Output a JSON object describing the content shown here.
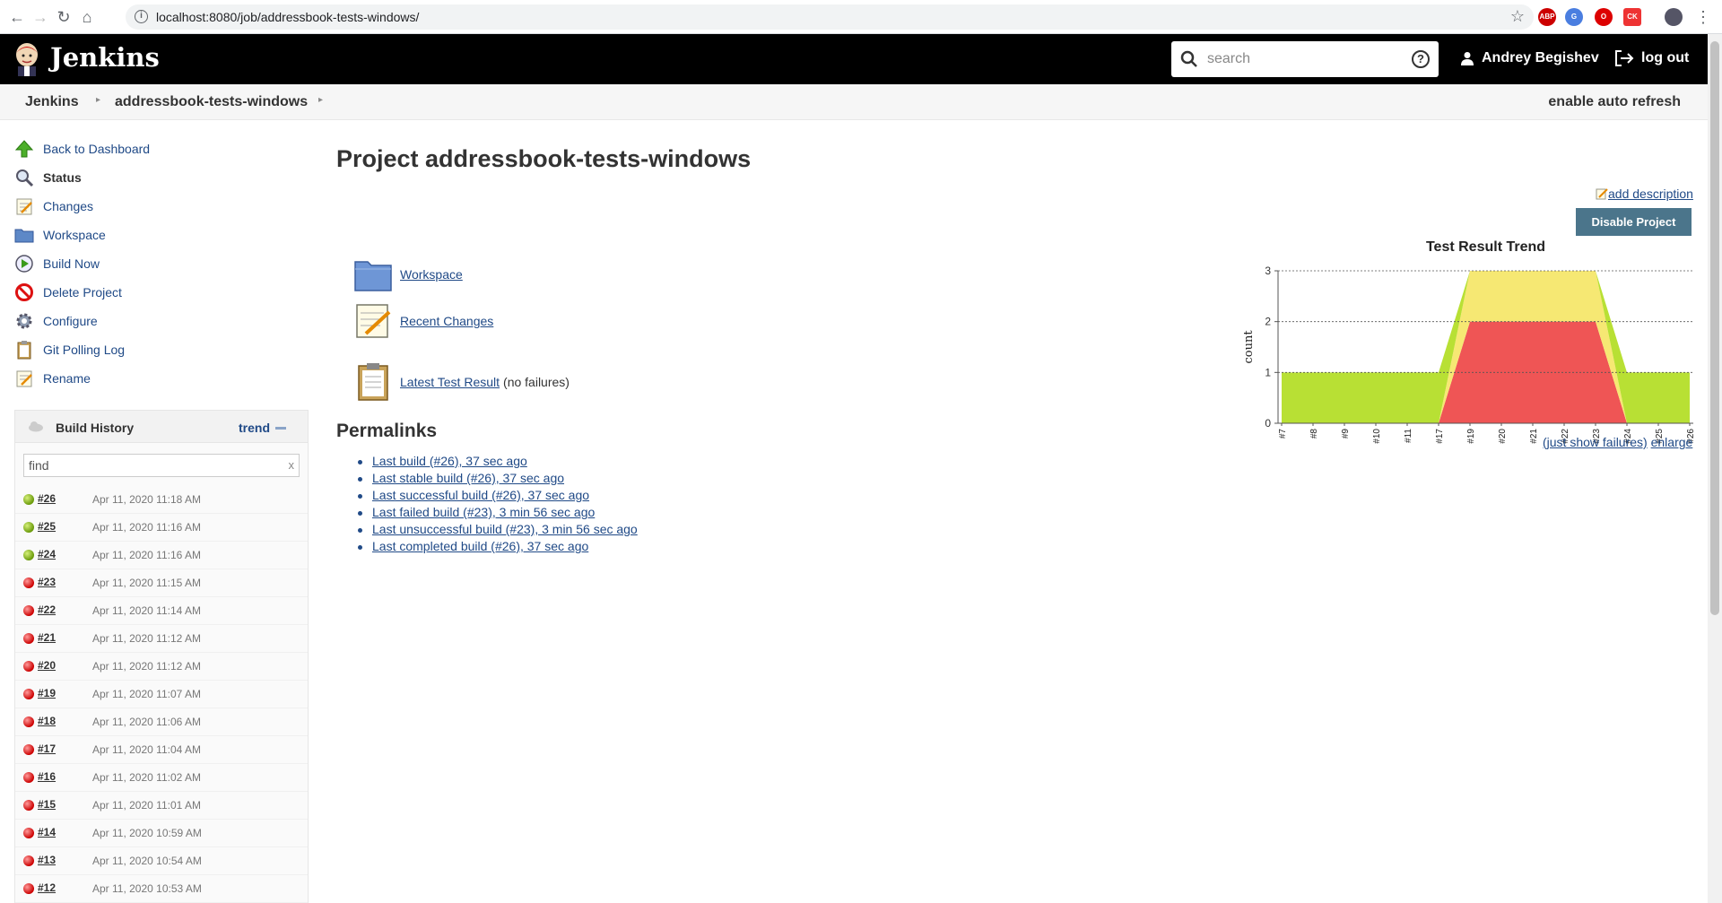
{
  "browser": {
    "url": "localhost:8080/job/addressbook-tests-windows/",
    "ext_labels": [
      "ABP",
      "G",
      "O",
      "CK"
    ]
  },
  "header": {
    "app_title": "Jenkins",
    "search_placeholder": "search",
    "help_label": "?",
    "user_name": "Andrey Begishev",
    "logout_label": "log out"
  },
  "breadcrumbs": {
    "items": [
      "Jenkins",
      "addressbook-tests-windows"
    ],
    "auto_refresh": "enable auto refresh"
  },
  "sidepanel": {
    "tasks": [
      {
        "label": "Back to Dashboard",
        "icon": "up-arrow-icon"
      },
      {
        "label": "Status",
        "icon": "search-icon"
      },
      {
        "label": "Changes",
        "icon": "notepad-icon"
      },
      {
        "label": "Workspace",
        "icon": "folder-icon"
      },
      {
        "label": "Build Now",
        "icon": "clock-play-icon"
      },
      {
        "label": "Delete Project",
        "icon": "no-entry-icon"
      },
      {
        "label": "Configure",
        "icon": "gear-icon"
      },
      {
        "label": "Git Polling Log",
        "icon": "clipboard-icon"
      },
      {
        "label": "Rename",
        "icon": "notepad-icon"
      }
    ]
  },
  "history": {
    "title": "Build History",
    "trend_label": "trend",
    "find_value": "find",
    "clear_label": "x",
    "builds": [
      {
        "num": "#26",
        "date": "Apr 11, 2020 11:18 AM",
        "status": "green"
      },
      {
        "num": "#25",
        "date": "Apr 11, 2020 11:16 AM",
        "status": "green"
      },
      {
        "num": "#24",
        "date": "Apr 11, 2020 11:16 AM",
        "status": "green"
      },
      {
        "num": "#23",
        "date": "Apr 11, 2020 11:15 AM",
        "status": "red"
      },
      {
        "num": "#22",
        "date": "Apr 11, 2020 11:14 AM",
        "status": "red"
      },
      {
        "num": "#21",
        "date": "Apr 11, 2020 11:12 AM",
        "status": "red"
      },
      {
        "num": "#20",
        "date": "Apr 11, 2020 11:12 AM",
        "status": "red"
      },
      {
        "num": "#19",
        "date": "Apr 11, 2020 11:07 AM",
        "status": "red"
      },
      {
        "num": "#18",
        "date": "Apr 11, 2020 11:06 AM",
        "status": "red"
      },
      {
        "num": "#17",
        "date": "Apr 11, 2020 11:04 AM",
        "status": "red"
      },
      {
        "num": "#16",
        "date": "Apr 11, 2020 11:02 AM",
        "status": "red"
      },
      {
        "num": "#15",
        "date": "Apr 11, 2020 11:01 AM",
        "status": "red"
      },
      {
        "num": "#14",
        "date": "Apr 11, 2020 10:59 AM",
        "status": "red"
      },
      {
        "num": "#13",
        "date": "Apr 11, 2020 10:54 AM",
        "status": "red"
      },
      {
        "num": "#12",
        "date": "Apr 11, 2020 10:53 AM",
        "status": "red"
      }
    ]
  },
  "main": {
    "title": "Project addressbook-tests-windows",
    "add_description": "add description",
    "disable_button": "Disable Project",
    "links": {
      "workspace": "Workspace",
      "recent_changes": "Recent Changes",
      "latest_test_result": "Latest Test Result",
      "no_failures": "(no failures)"
    },
    "permalinks_title": "Permalinks",
    "permalinks": [
      "Last build (#26), 37 sec ago",
      "Last stable build (#26), 37 sec ago",
      "Last successful build (#26), 37 sec ago",
      "Last failed build (#23), 3 min 56 sec ago",
      "Last unsuccessful build (#23), 3 min 56 sec ago",
      "Last completed build (#26), 37 sec ago"
    ],
    "chart_links": {
      "just_show_failures": "(just show failures)",
      "enlarge": "enlarge"
    }
  },
  "colors": {
    "passed": "#b8e034",
    "skipped": "#f6e873",
    "failed": "#ef5555",
    "button": "#4b758b",
    "link": "#204a87"
  },
  "chart_data": {
    "type": "area",
    "title": "Test Result Trend",
    "ylabel": "count",
    "xlabel": "",
    "categories": [
      "#7",
      "#8",
      "#9",
      "#10",
      "#11",
      "#17",
      "#19",
      "#20",
      "#21",
      "#22",
      "#23",
      "#24",
      "#25",
      "#26"
    ],
    "ylim": [
      0,
      3
    ],
    "yticks": [
      0,
      1,
      2,
      3
    ],
    "stacked": true,
    "series": [
      {
        "key": "failed",
        "values": [
          0,
          0,
          0,
          0,
          0,
          0,
          2,
          2,
          2,
          2,
          2,
          0,
          0,
          0
        ]
      },
      {
        "key": "skipped",
        "values": [
          0,
          0,
          0,
          0,
          0,
          0,
          1,
          1,
          1,
          1,
          1,
          0,
          0,
          0
        ]
      },
      {
        "key": "passed",
        "values": [
          1,
          1,
          1,
          1,
          1,
          1,
          0,
          0,
          0,
          0,
          0,
          1,
          1,
          1
        ]
      }
    ]
  }
}
